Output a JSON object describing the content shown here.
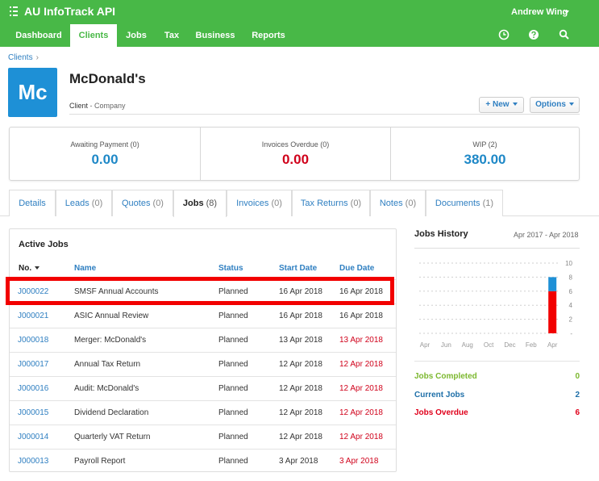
{
  "app": {
    "title": "AU InfoTrack API",
    "user": "Andrew Wing"
  },
  "nav": {
    "items": [
      "Dashboard",
      "Clients",
      "Jobs",
      "Tax",
      "Business",
      "Reports"
    ],
    "active": "Clients",
    "icons": [
      "clock-icon",
      "help-icon",
      "search-icon"
    ]
  },
  "breadcrumb": {
    "root": "Clients",
    "separator": "›"
  },
  "client": {
    "initials": "Mc",
    "name": "McDonald's",
    "type": "Client",
    "subtype": "- Company"
  },
  "actions": {
    "new_label": "+ New",
    "options_label": "Options"
  },
  "stats": [
    {
      "label": "Awaiting Payment (0)",
      "value": "0.00",
      "color": "#1e88c7"
    },
    {
      "label": "Invoices Overdue (0)",
      "value": "0.00",
      "color": "#d0021b"
    },
    {
      "label": "WIP (2)",
      "value": "380.00",
      "color": "#1e88c7"
    }
  ],
  "tabs": [
    {
      "label": "Details",
      "count": ""
    },
    {
      "label": "Leads",
      "count": "(0)"
    },
    {
      "label": "Quotes",
      "count": "(0)"
    },
    {
      "label": "Jobs",
      "count": "(8)"
    },
    {
      "label": "Invoices",
      "count": "(0)"
    },
    {
      "label": "Tax Returns",
      "count": "(0)"
    },
    {
      "label": "Notes",
      "count": "(0)"
    },
    {
      "label": "Documents",
      "count": "(1)"
    }
  ],
  "active_tab": "Jobs",
  "active_jobs": {
    "title": "Active Jobs",
    "columns": {
      "no": "No.",
      "name": "Name",
      "status": "Status",
      "start": "Start Date",
      "due": "Due Date"
    },
    "rows": [
      {
        "no": "J000022",
        "name": "SMSF Annual Accounts",
        "status": "Planned",
        "start": "16 Apr 2018",
        "due": "16 Apr 2018",
        "overdue": false
      },
      {
        "no": "J000021",
        "name": "ASIC Annual Review",
        "status": "Planned",
        "start": "16 Apr 2018",
        "due": "16 Apr 2018",
        "overdue": false
      },
      {
        "no": "J000018",
        "name": "Merger: McDonald's",
        "status": "Planned",
        "start": "13 Apr 2018",
        "due": "13 Apr 2018",
        "overdue": true
      },
      {
        "no": "J000017",
        "name": "Annual Tax Return",
        "status": "Planned",
        "start": "12 Apr 2018",
        "due": "12 Apr 2018",
        "overdue": true
      },
      {
        "no": "J000016",
        "name": "Audit: McDonald's",
        "status": "Planned",
        "start": "12 Apr 2018",
        "due": "12 Apr 2018",
        "overdue": true
      },
      {
        "no": "J000015",
        "name": "Dividend Declaration",
        "status": "Planned",
        "start": "12 Apr 2018",
        "due": "12 Apr 2018",
        "overdue": true
      },
      {
        "no": "J000014",
        "name": "Quarterly VAT Return",
        "status": "Planned",
        "start": "12 Apr 2018",
        "due": "12 Apr 2018",
        "overdue": true
      },
      {
        "no": "J000013",
        "name": "Payroll Report",
        "status": "Planned",
        "start": "3 Apr 2018",
        "due": "3 Apr 2018",
        "overdue": true
      }
    ]
  },
  "jobs_history": {
    "title": "Jobs History",
    "range": "Apr 2017 - Apr 2018",
    "summary": [
      {
        "label": "Jobs Completed",
        "count": "0",
        "color": "#7cb82f"
      },
      {
        "label": "Current Jobs",
        "count": "2",
        "color": "#1e6fa8"
      },
      {
        "label": "Jobs Overdue",
        "count": "6",
        "color": "#e0001b"
      }
    ]
  },
  "chart_data": {
    "type": "bar",
    "stacked": true,
    "categories": [
      "Apr",
      "Jun",
      "Aug",
      "Oct",
      "Dec",
      "Feb",
      "Apr"
    ],
    "series": [
      {
        "name": "Jobs Overdue",
        "color": "#f20000",
        "values": [
          0,
          0,
          0,
          0,
          0,
          0,
          6
        ]
      },
      {
        "name": "Current Jobs",
        "color": "#1e90d6",
        "values": [
          0,
          0,
          0,
          0,
          0,
          0,
          2
        ]
      }
    ],
    "y_ticks": [
      "10",
      "8",
      "6",
      "4",
      "2",
      "-"
    ],
    "ylim": [
      0,
      10
    ],
    "grid": true
  }
}
